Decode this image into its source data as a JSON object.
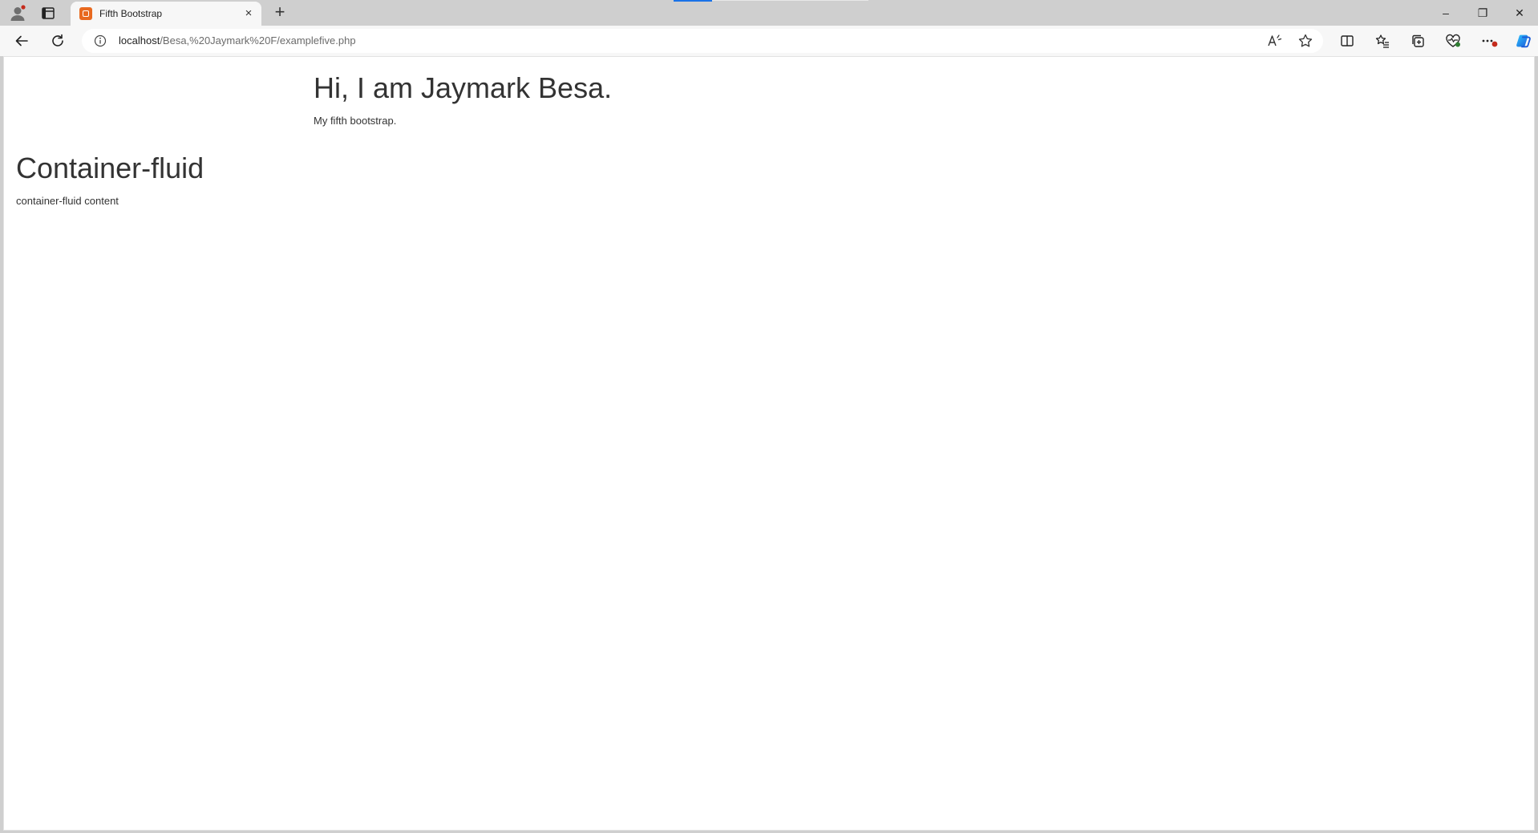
{
  "browser": {
    "tab": {
      "title": "Fifth Bootstrap",
      "close_glyph": "×"
    },
    "new_tab_glyph": "+",
    "address": {
      "host": "localhost",
      "path": "/Besa,%20Jaymark%20F/examplefive.php"
    },
    "icons": {
      "profile": "profile-icon",
      "tab_actions": "tab-actions-icon",
      "favicon": "xampp-favicon",
      "back": "back-arrow-icon",
      "refresh": "refresh-icon",
      "info": "info-icon",
      "read_aloud": "read-aloud-icon",
      "favorite": "star-icon",
      "split_screen": "split-screen-icon",
      "favorites": "favorites-list-icon",
      "collections": "collections-icon",
      "browser_essentials": "heart-pulse-icon",
      "more": "more-icon",
      "copilot": "copilot-icon"
    },
    "window_controls": {
      "minimize": "–",
      "restore": "❐",
      "close": "✕"
    },
    "colors": {
      "accent": "#1a73e8",
      "favicon": "#e8691f",
      "badge": "#c42b1c"
    }
  },
  "page": {
    "jumbotron": {
      "title": "Hi, I am Jaymark Besa.",
      "subtitle": "My fifth bootstrap."
    },
    "container_fluid": {
      "title": "Container-fluid",
      "content": "container-fluid content"
    }
  }
}
